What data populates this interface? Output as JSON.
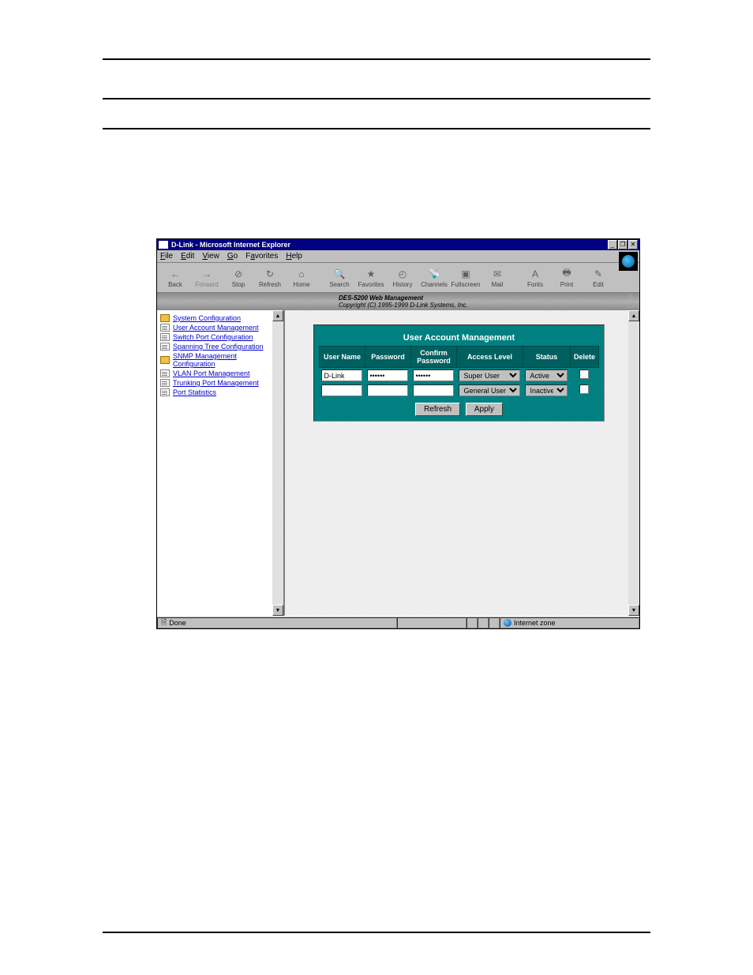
{
  "window": {
    "title": "D-Link - Microsoft Internet Explorer",
    "menus": [
      "File",
      "Edit",
      "View",
      "Go",
      "Favorites",
      "Help"
    ],
    "toolbar": [
      {
        "label": "Back",
        "glyph": "←"
      },
      {
        "label": "Forward",
        "glyph": "→",
        "disabled": true
      },
      {
        "label": "Stop",
        "glyph": "⊘"
      },
      {
        "label": "Refresh",
        "glyph": "↻"
      },
      {
        "label": "Home",
        "glyph": "⌂"
      },
      {
        "label": "Search",
        "glyph": "🔍"
      },
      {
        "label": "Favorites",
        "glyph": "★"
      },
      {
        "label": "History",
        "glyph": "◴"
      },
      {
        "label": "Channels",
        "glyph": "📡"
      },
      {
        "label": "Fullscreen",
        "glyph": "▣"
      },
      {
        "label": "Mail",
        "glyph": "✉"
      },
      {
        "label": "Fonts",
        "glyph": "A"
      },
      {
        "label": "Print",
        "glyph": "🖶"
      },
      {
        "label": "Edit",
        "glyph": "✎"
      }
    ],
    "status": {
      "text": "Done",
      "zone": "Internet zone"
    }
  },
  "banner": {
    "product": "DES-5200 Web Management",
    "copyright": "Copyright (C) 1995-1999 D-Link Systems, Inc."
  },
  "nav": [
    {
      "label": "System Configuration",
      "icon": "folder"
    },
    {
      "label": "User Account Management",
      "icon": "page"
    },
    {
      "label": "Switch Port Configuration",
      "icon": "page"
    },
    {
      "label": "Spanning Tree Configuration",
      "icon": "page"
    },
    {
      "label": "SNMP Management Configuration",
      "icon": "folder"
    },
    {
      "label": "VLAN Port Management",
      "icon": "page"
    },
    {
      "label": "Trunking Port Management",
      "icon": "page"
    },
    {
      "label": "Port Statistics",
      "icon": "page"
    }
  ],
  "panel": {
    "title": "User Account Management",
    "columns": [
      "User Name",
      "Password",
      "Confirm Password",
      "Access Level",
      "Status",
      "Delete"
    ],
    "access_options": [
      "Super User",
      "General User"
    ],
    "status_options": [
      "Active",
      "Inactive"
    ],
    "rows": [
      {
        "user": "D-Link",
        "pwd": "••••••",
        "cpwd": "••••••",
        "access": "Super User",
        "status": "Active",
        "del": false
      },
      {
        "user": "",
        "pwd": "",
        "cpwd": "",
        "access": "General User",
        "status": "Inactive",
        "del": false
      }
    ],
    "buttons": {
      "refresh": "Refresh",
      "apply": "Apply"
    }
  }
}
